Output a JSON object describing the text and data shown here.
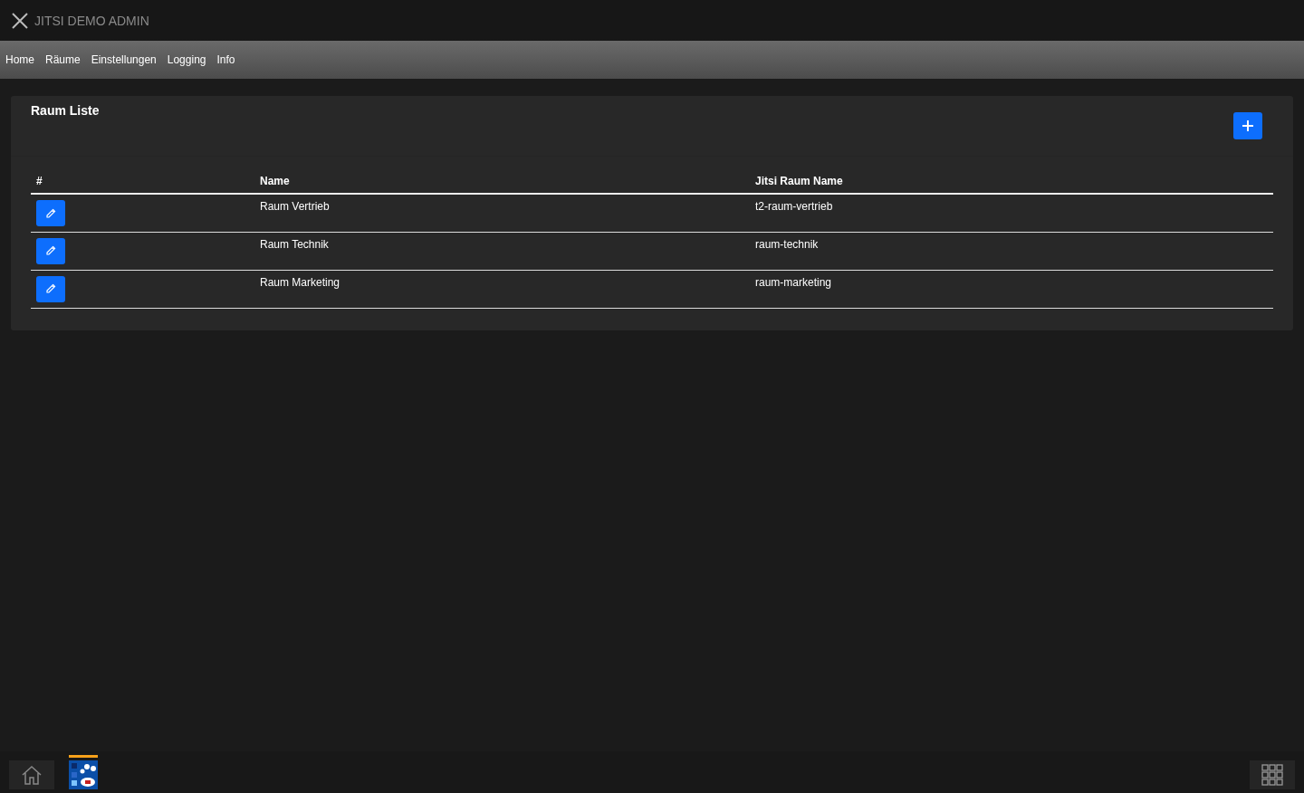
{
  "window": {
    "title": "JITSI DEMO ADMIN"
  },
  "nav": [
    "Home",
    "Räume",
    "Einstellungen",
    "Logging",
    "Info"
  ],
  "card": {
    "title": "Raum Liste"
  },
  "table": {
    "columns": [
      "#",
      "Name",
      "Jitsi Raum Name"
    ],
    "rows": [
      {
        "name": "Raum Vertrieb",
        "jitsi": "t2-raum-vertrieb"
      },
      {
        "name": "Raum Technik",
        "jitsi": "raum-technik"
      },
      {
        "name": "Raum Marketing",
        "jitsi": "raum-marketing"
      }
    ]
  },
  "taskbar": {
    "apps": [
      {
        "active": true
      }
    ]
  }
}
